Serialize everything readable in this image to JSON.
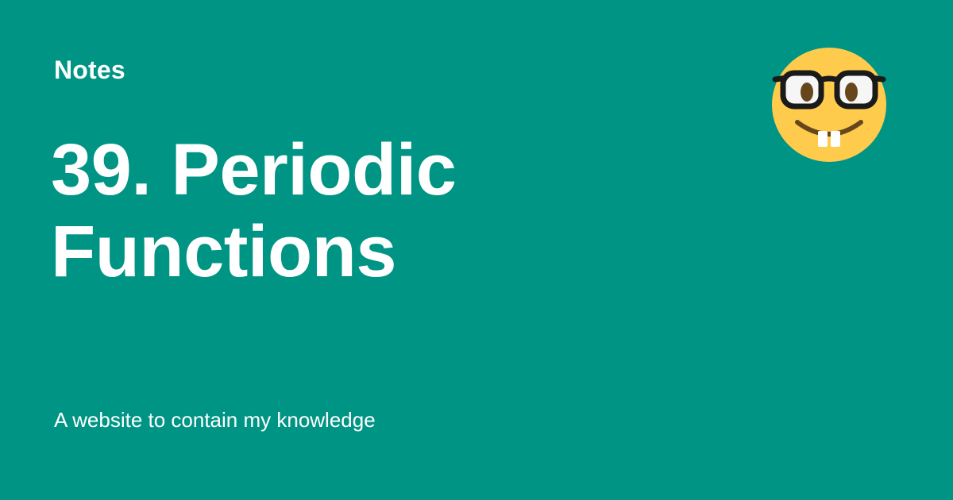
{
  "site": {
    "name": "Notes",
    "logo_icon": "nerd-face-emoji-icon"
  },
  "page": {
    "title": "39. Periodic Functions",
    "description": "A website to contain my knowledge"
  },
  "colors": {
    "background": "#009485",
    "text": "#ffffff",
    "emoji_face": "#ffcb4c",
    "emoji_features": "#65471b"
  }
}
